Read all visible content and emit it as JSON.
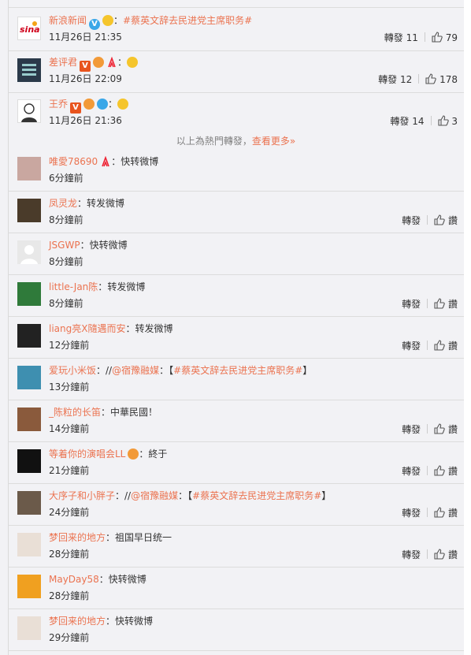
{
  "hot_reposts": [
    {
      "user": "新浪新闻",
      "sep": "：",
      "text": "#蔡英文辞去民进党主席职务#",
      "time": "11月26日 21:35",
      "repost_label": "轉發",
      "repost_count": "11",
      "like_count": "79",
      "badges": [
        "vb-icon",
        "crown-emoji"
      ]
    },
    {
      "user": "差评君",
      "sep": "：",
      "text": "",
      "time": "11月26日 22:09",
      "repost_label": "轉發",
      "repost_count": "12",
      "like_count": "178",
      "badges": [
        "vip-icon",
        "medal-icon",
        "red-ribbon-icon",
        "crying-emoji"
      ]
    },
    {
      "user": "王乔",
      "sep": "：",
      "text": "",
      "time": "11月26日 21:36",
      "repost_label": "轉發",
      "repost_count": "14",
      "like_count": "3",
      "badges": [
        "vip-icon",
        "crown-emoji",
        "blue-badge-icon",
        "smile-emoji"
      ]
    }
  ],
  "more": {
    "prefix": "以上為熱門轉發，",
    "link": "查看更多»"
  },
  "reposts": [
    {
      "user": "唯愛78690",
      "sep": "：",
      "text": "快转微博",
      "time": "6分鐘前",
      "show_actions": false
    },
    {
      "user": "凤灵龙",
      "sep": "：",
      "text": "转发微博",
      "time": "8分鐘前",
      "show_actions": true
    },
    {
      "user": "JSGWP",
      "sep": "：",
      "text": "快转微博",
      "time": "8分鐘前",
      "show_actions": false
    },
    {
      "user": "little-Jan陈",
      "sep": "：",
      "text": "转发微博",
      "time": "8分鐘前",
      "show_actions": true
    },
    {
      "user": "liang亮X隨遇而安",
      "sep": "：",
      "text": "转发微博",
      "time": "12分鐘前",
      "show_actions": true
    },
    {
      "user": "爱玩小米饭",
      "sep": "：//",
      "text": "@宿豫融媒",
      "text2": "：【",
      "tag": "#蔡英文辞去民进党主席职务#",
      "text3": "】",
      "time": "13分鐘前",
      "show_actions": false
    },
    {
      "user": "_陈粒的长笛",
      "sep": "：",
      "text": "中華民國！",
      "time": "14分鐘前",
      "show_actions": true
    },
    {
      "user": "等着你的演唱会LL",
      "sep": "：",
      "text": "終于",
      "time": "21分鐘前",
      "show_actions": true
    },
    {
      "user": "大序子和小胖子",
      "sep": "：//",
      "text": "@宿豫融媒",
      "text2": "：【",
      "tag": "#蔡英文辞去民进党主席职务#",
      "text3": "】",
      "time": "24分鐘前",
      "show_actions": true
    },
    {
      "user": "梦回来的地方",
      "sep": "：",
      "text": "祖国早日统一",
      "time": "28分鐘前",
      "show_actions": true
    },
    {
      "user": "MayDay58",
      "sep": "：",
      "text": "快转微博",
      "time": "28分鐘前",
      "show_actions": false
    },
    {
      "user": "梦回来的地方",
      "sep": "：",
      "text": "快转微博",
      "time": "29分鐘前",
      "show_actions": false
    }
  ],
  "action_labels": {
    "repost": "轉發",
    "like": "讚"
  },
  "colors": {
    "accent": "#eb7350",
    "background": "#f2f2f5"
  }
}
